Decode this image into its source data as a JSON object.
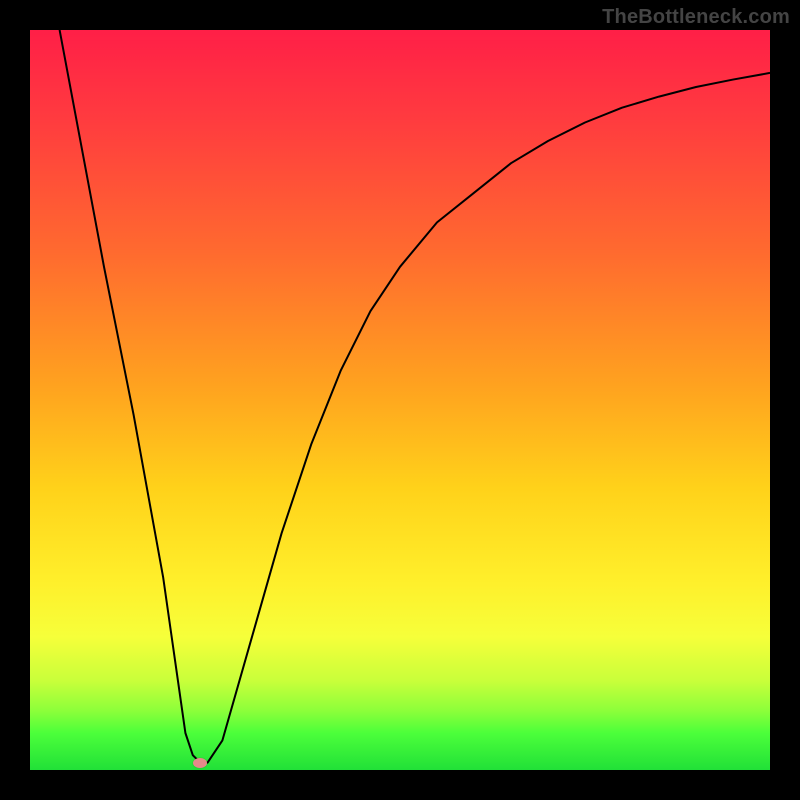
{
  "watermark": "TheBottleneck.com",
  "chart_data": {
    "type": "line",
    "title": "",
    "xlabel": "",
    "ylabel": "",
    "xlim": [
      0,
      100
    ],
    "ylim": [
      0,
      100
    ],
    "annotations": [],
    "series": [
      {
        "name": "curve",
        "x": [
          4,
          10,
          14,
          18,
          20,
          21,
          22,
          23,
          24,
          26,
          30,
          34,
          38,
          42,
          46,
          50,
          55,
          60,
          65,
          70,
          75,
          80,
          85,
          90,
          95,
          100
        ],
        "y": [
          100,
          68,
          48,
          26,
          12,
          5,
          2,
          1,
          1,
          4,
          18,
          32,
          44,
          54,
          62,
          68,
          74,
          78,
          82,
          85,
          87.5,
          89.5,
          91,
          92.3,
          93.3,
          94.2
        ]
      }
    ],
    "marker": {
      "x": 23,
      "y": 1
    }
  },
  "colors": {
    "curve_stroke": "#000000",
    "marker_fill": "#e58a8a",
    "frame_bg": "#000000"
  }
}
